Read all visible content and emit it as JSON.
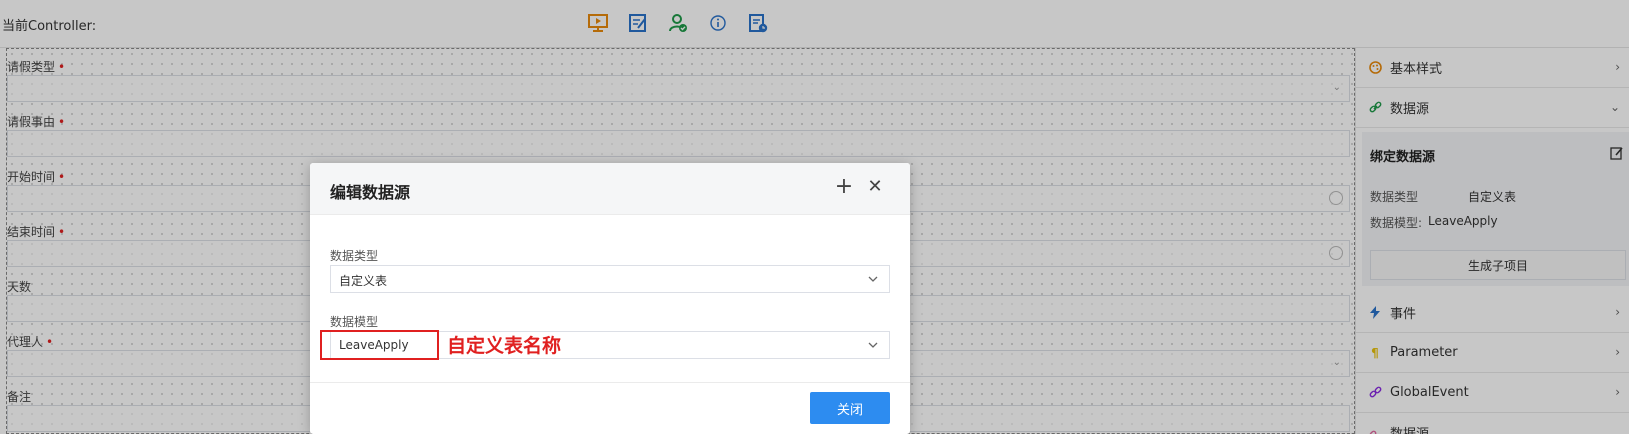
{
  "header": {
    "controller_label": "当前Controller:",
    "toolbar_icons": [
      "preview-icon",
      "edit-form-icon",
      "user-check-icon",
      "info-icon",
      "schedule-icon"
    ]
  },
  "form": {
    "fields": [
      {
        "label": "请假类型",
        "required": true,
        "control": "select"
      },
      {
        "label": "请假事由",
        "required": true,
        "control": "text"
      },
      {
        "label": "开始时间",
        "required": true,
        "control": "datetime"
      },
      {
        "label": "结束时间",
        "required": true,
        "control": "datetime"
      },
      {
        "label": "天数",
        "required": false,
        "control": "text"
      },
      {
        "label": "代理人",
        "required": true,
        "control": "select"
      },
      {
        "label": "备注",
        "required": false,
        "control": "text"
      }
    ],
    "required_mark": "•"
  },
  "right_panel": {
    "sections": {
      "basic_style": "基本样式",
      "data_source": "数据源",
      "events": "事件",
      "parameter": "Parameter",
      "global_event": "GlobalEvent",
      "data_source_2": "数据源"
    },
    "binding": {
      "title": "绑定数据源",
      "data_type_key": "数据类型",
      "data_type_value": "自定义表",
      "data_model_key": "数据模型:",
      "data_model_value": "LeaveApply",
      "generate_button": "生成子项目"
    }
  },
  "dialog": {
    "title": "编辑数据源",
    "data_type_label": "数据类型",
    "data_type_value": "自定义表",
    "data_model_label": "数据模型",
    "data_model_value": "LeaveApply",
    "close_button": "关闭"
  },
  "annotation": {
    "text": "自定义表名称",
    "color": "#e02020"
  },
  "colors": {
    "primary": "#2d8cf0",
    "toolbar_orange": "#e8890c",
    "toolbar_blue": "#2a72c9",
    "toolbar_green": "#1f9a4a"
  }
}
